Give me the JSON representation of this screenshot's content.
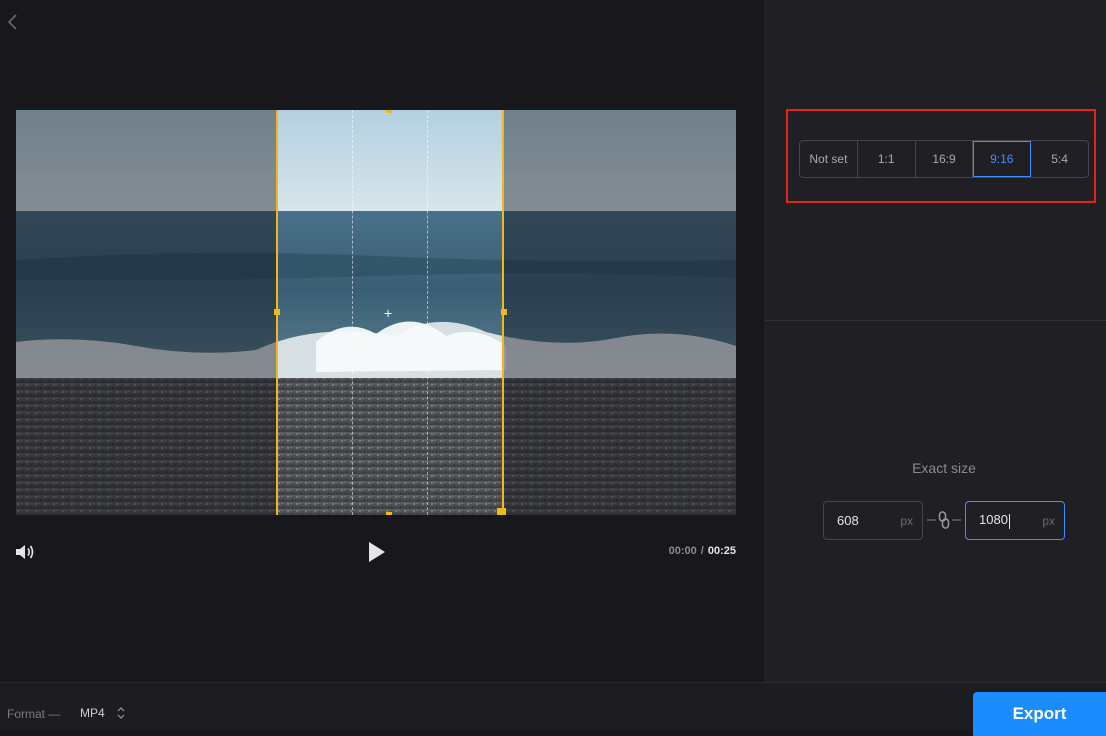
{
  "player": {
    "current_time": "00:00",
    "separator": "/",
    "total_time": "00:25"
  },
  "aspect_ratio": {
    "options": [
      "Not set",
      "1:1",
      "16:9",
      "9:16",
      "5:4"
    ],
    "selected": "9:16"
  },
  "exact_size": {
    "label": "Exact size",
    "width": "608",
    "height": "1080",
    "unit": "px"
  },
  "footer": {
    "format_label": "Format —",
    "format_value": "MP4",
    "export_label": "Export"
  },
  "colors": {
    "accent": "#1a8cff",
    "crop_frame": "#f1b81e",
    "annotation_highlight": "#e1251b"
  },
  "icons": [
    "back-icon",
    "volume-icon",
    "play-icon",
    "link-icon",
    "format-stepper-icon"
  ]
}
